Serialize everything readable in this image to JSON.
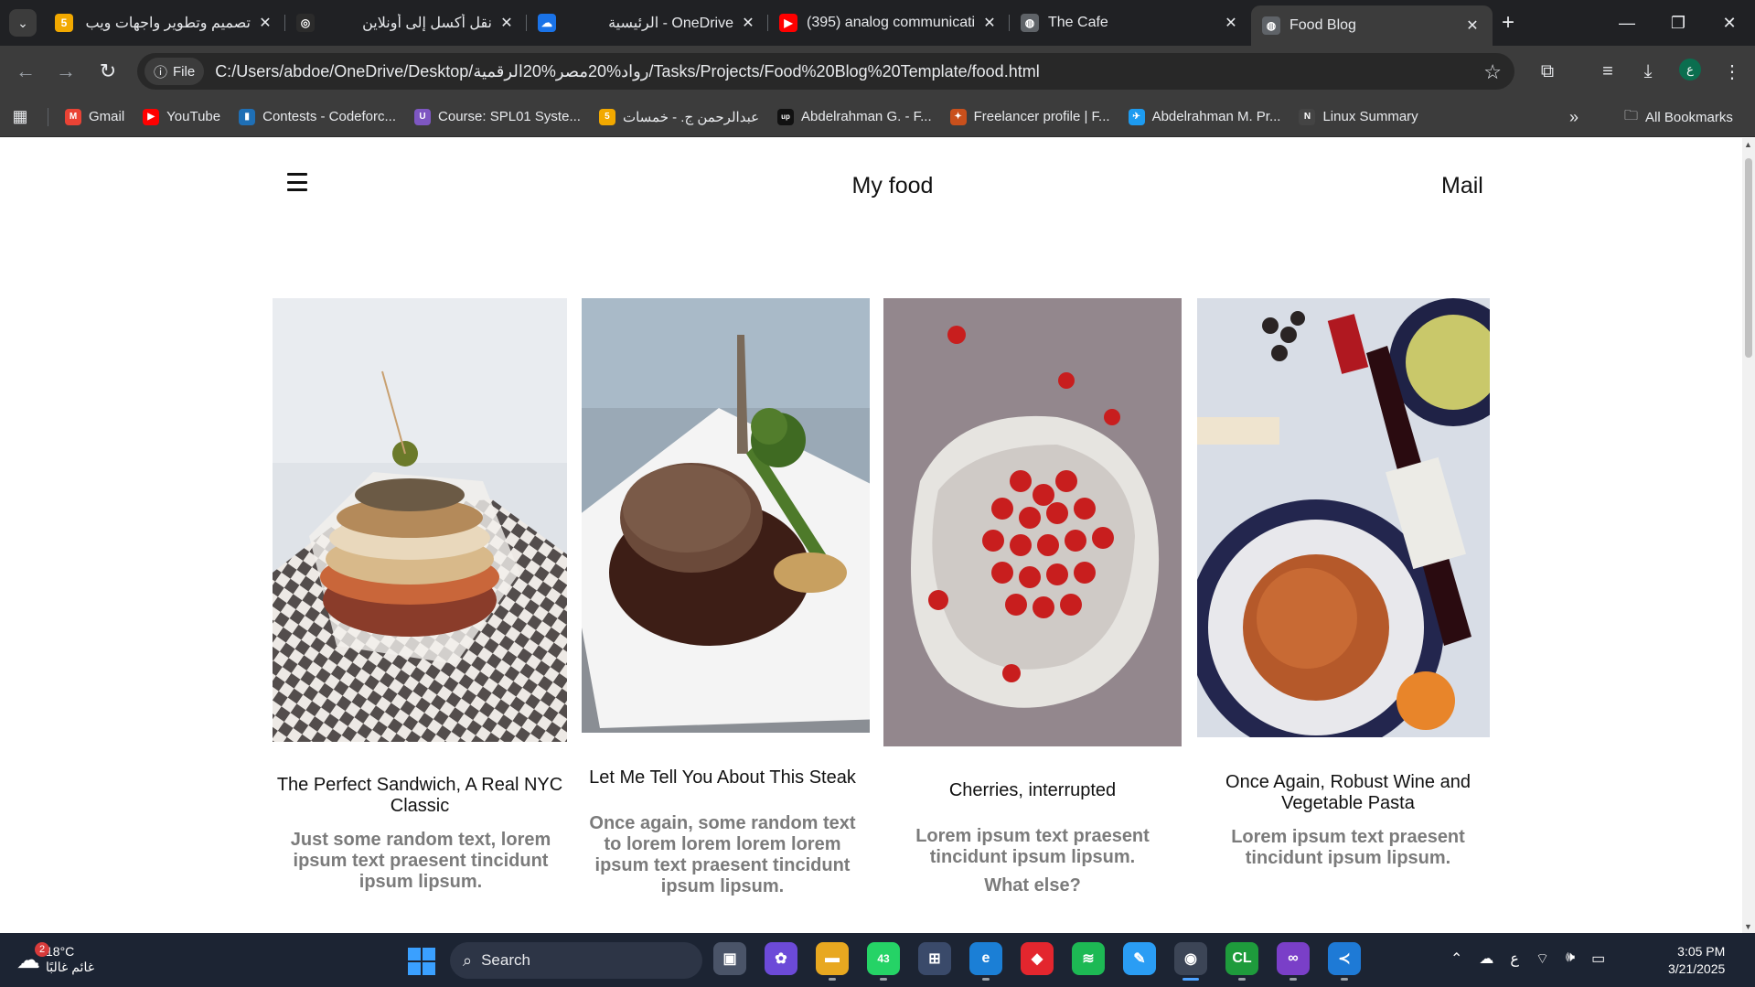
{
  "browser": {
    "tabs": [
      {
        "title": "تصميم وتطوير واجهات ويب",
        "rtl": true,
        "favicon_color": "#f2a900",
        "favicon_glyph": "5"
      },
      {
        "title": "نقل أكسل إلى أونلاين",
        "rtl": true,
        "favicon_color": "#2b2b2b",
        "favicon_glyph": "◎"
      },
      {
        "title": "OneDrive - الرئيسية",
        "rtl": true,
        "favicon_color": "#1a73e8",
        "favicon_glyph": "☁"
      },
      {
        "title": "(395) analog communicatic",
        "rtl": false,
        "favicon_color": "#ff0000",
        "favicon_glyph": "▶"
      },
      {
        "title": "The Cafe",
        "rtl": false,
        "favicon_color": "#5f6368",
        "favicon_glyph": "◍"
      },
      {
        "title": "Food Blog",
        "rtl": false,
        "favicon_color": "#5f6368",
        "favicon_glyph": "◍",
        "active": true
      }
    ],
    "omnibox": {
      "chip_label": "File",
      "url": "C:/Users/abdoe/OneDrive/Desktop/رواد%20مصر%20الرقمية/Tasks/Projects/Food%20Blog%20Template/food.html"
    },
    "profile_initial": "ع",
    "bookmarks": [
      {
        "label": "Gmail",
        "color": "#ea4335",
        "glyph": "M"
      },
      {
        "label": "YouTube",
        "color": "#ff0000",
        "glyph": "▶"
      },
      {
        "label": "Contests - Codeforc...",
        "color": "#1f6fb5",
        "glyph": "▮"
      },
      {
        "label": "Course: SPL01 Syste...",
        "color": "#7e57c2",
        "glyph": "U"
      },
      {
        "label": "عبدالرحمن ج. - خمسات",
        "color": "#f2a900",
        "glyph": "5"
      },
      {
        "label": "Abdelrahman G. - F...",
        "color": "#111111",
        "glyph": "up"
      },
      {
        "label": "Freelancer profile | F...",
        "color": "#c9501c",
        "glyph": "✦"
      },
      {
        "label": "Abdelrahman M. Pr...",
        "color": "#1d9bf0",
        "glyph": "✈"
      },
      {
        "label": "Linux Summary",
        "color": "#444444",
        "glyph": "N"
      }
    ],
    "all_bookmarks_label": "All Bookmarks"
  },
  "site": {
    "title": "My food",
    "mail": "Mail",
    "cards": [
      {
        "heading": "The Perfect Sandwich, A Real NYC Classic",
        "text": "Just some random text, lorem ipsum text praesent tincidunt ipsum lipsum.",
        "extra": ""
      },
      {
        "heading": "Let Me Tell You About This Steak",
        "text": "Once again, some random text to lorem lorem lorem lorem ipsum text praesent tincidunt ipsum lipsum.",
        "extra": ""
      },
      {
        "heading": "Cherries, interrupted",
        "text": "Lorem ipsum text praesent tincidunt ipsum lipsum.",
        "extra": "What else?"
      },
      {
        "heading": "Once Again, Robust Wine and Vegetable Pasta",
        "text": "Lorem ipsum text praesent tincidunt ipsum lipsum.",
        "extra": ""
      }
    ]
  },
  "taskbar": {
    "weather": {
      "temp": "18°C",
      "desc": "غائم غالبًا",
      "badge": "2"
    },
    "search_label": "Search",
    "whatsapp_badge": "43",
    "lang": "ع",
    "time": "3:05 PM",
    "date": "3/21/2025"
  }
}
